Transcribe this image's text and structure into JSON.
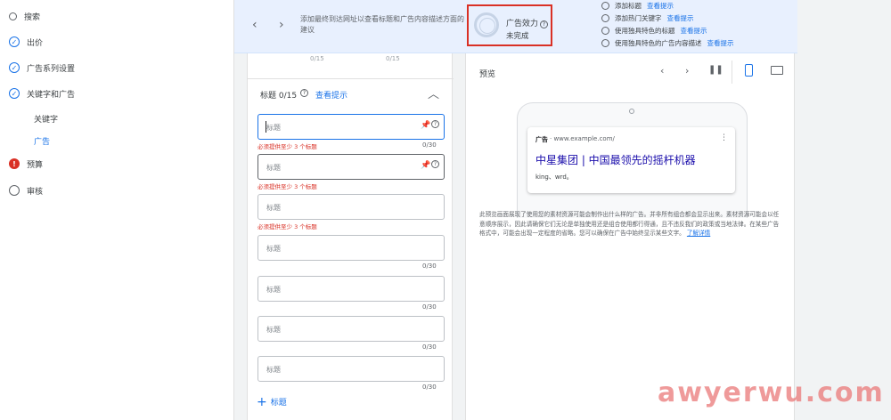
{
  "sidebar": {
    "items": [
      {
        "label": "搜索",
        "icon": "search-icon"
      },
      {
        "label": "出价",
        "icon": "check-circle-icon"
      },
      {
        "label": "广告系列设置",
        "icon": "check-circle-icon"
      },
      {
        "label": "关键字和广告",
        "icon": "check-circle-icon"
      },
      {
        "label": "预算",
        "icon": "error-icon"
      },
      {
        "label": "审核",
        "icon": "empty-circle-icon"
      }
    ],
    "sub_items": [
      {
        "label": "关键字"
      },
      {
        "label": "广告",
        "active": true
      }
    ]
  },
  "topbar": {
    "hint": "添加最终到达网址以查看标题和广告内容描述方面的建议",
    "effect_title": "广告效力",
    "effect_status": "未完成",
    "suggestions": [
      {
        "label": "添加标题",
        "link": "查看提示"
      },
      {
        "label": "添加热门关键字",
        "link": "查看提示"
      },
      {
        "label": "使用独具特色的标题",
        "link": "查看提示"
      },
      {
        "label": "使用独具特色的广告内容描述",
        "link": "查看提示"
      }
    ]
  },
  "editor": {
    "top_counters": [
      "0/15",
      "0/15"
    ],
    "section_title": "标题 0/15",
    "tip_link": "查看提示",
    "placeholder": "标题",
    "error_text": "必须提供至少 3 个标题",
    "counter": "0/30",
    "add_label": "标题"
  },
  "preview": {
    "title": "预览",
    "ad_badge": "广告",
    "ad_url": "· www.example.com/",
    "ad_headline": "中星集团 | 中国最领先的摇杆机器",
    "ad_description": "king、wrd。",
    "note": "此预览画面展现了使用您的素材资源可能会制作出什么样的广告。并非所有组合都会显示出来。素材资源可能会以任意顺序展示，因此请确保它们无论是单独使用还是组合使用都行得通，且不违反我们的政策或当地法律。在某些广告格式中，可能会出现一定程度的省略。您可以确保在广告中始终显示某些文字。",
    "note_link": "了解详情"
  },
  "watermark": "awyerwu.com"
}
